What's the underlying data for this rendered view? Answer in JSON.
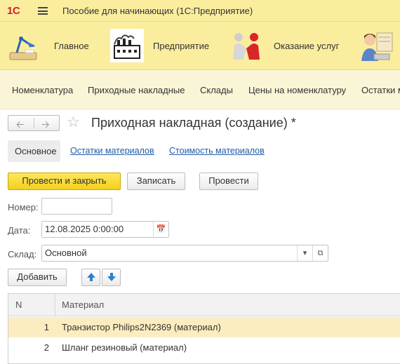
{
  "app": {
    "logo": "1С",
    "title": "Пособие для начинающих  (1С:Предприятие)"
  },
  "sections": [
    {
      "label": "Главное",
      "icon": "desk-lamp-icon"
    },
    {
      "label": "Предприятие",
      "icon": "factory-icon"
    },
    {
      "label": "Оказание услуг",
      "icon": "handshake-icon"
    },
    {
      "label": "",
      "icon": "accountant-icon"
    }
  ],
  "nav": {
    "items": [
      "Номенклатура",
      "Приходные накладные",
      "Склады",
      "Цены на номенклатуру",
      "Остатки м"
    ]
  },
  "form": {
    "title": "Приходная накладная (создание) *",
    "tabs": {
      "main": "Основное",
      "links": [
        "Остатки материалов",
        "Стоимость материалов"
      ]
    },
    "buttons": {
      "post_close": "Провести и закрыть",
      "save": "Записать",
      "post": "Провести"
    },
    "fields": {
      "number_label": "Номер:",
      "number_value": "",
      "date_label": "Дата:",
      "date_value": "12.08.2025  0:00:00",
      "warehouse_label": "Склад:",
      "warehouse_value": "Основной"
    },
    "table_toolbar": {
      "add": "Добавить"
    },
    "table": {
      "columns": [
        "N",
        "Материал"
      ],
      "rows": [
        {
          "n": "1",
          "material": "Транзистор Philips2N2369 (материал)",
          "selected": true
        },
        {
          "n": "2",
          "material": "Шланг резиновый (материал)",
          "selected": false
        }
      ]
    }
  },
  "colors": {
    "header_yellow": "#fbed9e",
    "nav_panel": "#fbf5d8",
    "primary_button": "#f5cf1c",
    "link_blue": "#1f5ca6",
    "selected_row": "#fbedbf",
    "arrow_blue": "#2f7fcf"
  }
}
